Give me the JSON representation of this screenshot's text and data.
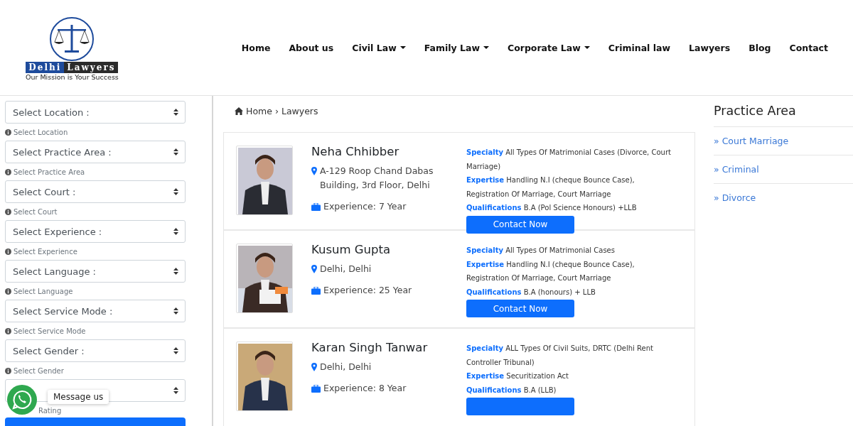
{
  "logo": {
    "name_part_1": "Delhi",
    "name_part_2": "Lawyers",
    "tagline": "Our Mission is Your Success"
  },
  "nav": [
    {
      "label": "Home",
      "dropdown": false
    },
    {
      "label": "About us",
      "dropdown": false
    },
    {
      "label": "Civil Law",
      "dropdown": true
    },
    {
      "label": "Family Law",
      "dropdown": true
    },
    {
      "label": "Corporate Law",
      "dropdown": true
    },
    {
      "label": "Criminal law",
      "dropdown": false
    },
    {
      "label": "Lawyers",
      "dropdown": false
    },
    {
      "label": "Blog",
      "dropdown": false
    },
    {
      "label": "Contact",
      "dropdown": false
    }
  ],
  "filters": [
    {
      "value": "Select Location :",
      "hint": "Select Location"
    },
    {
      "value": "Select Practice Area :",
      "hint": "Select Practice Area"
    },
    {
      "value": "Select Court :",
      "hint": "Select Court"
    },
    {
      "value": "Select Experience :",
      "hint": "Select Experience"
    },
    {
      "value": "Select Language :",
      "hint": "Select Language"
    },
    {
      "value": "Select Service Mode :",
      "hint": "Select Service Mode"
    },
    {
      "value": "Select Gender :",
      "hint": "Select Gender"
    },
    {
      "kind": "covered",
      "hint": "Rating"
    }
  ],
  "chat_widget": {
    "label": "Message us"
  },
  "breadcrumb": {
    "home": "Home",
    "separator": "›",
    "current": "Lawyers"
  },
  "lawyers": [
    {
      "name": "Neha Chhibber",
      "address": "A-129 Roop Chand Dabas Building, 3rd Floor, Delhi",
      "experience": "Experience: 7 Year",
      "details": [
        {
          "label": "Specialty",
          "text": "All Types Of Matrimonial Cases (Divorce, Court Marriage)"
        },
        {
          "label": "Expertise",
          "text": "Handling N.I (cheque Bounce Case), Registration Of Marriage, Court Marriage"
        },
        {
          "label": "Qualifications",
          "text": "B.A (Pol Science Honours) +LLB"
        }
      ],
      "button": "Contact Now"
    },
    {
      "name": "Kusum Gupta",
      "address": "Delhi, Delhi",
      "experience": "Experience: 25 Year",
      "details": [
        {
          "label": "Specialty",
          "text": "All Types Of Matrimonial Cases"
        },
        {
          "label": "Expertise",
          "text": "Handling N.I (cheque Bounce Case), Registration Of Marriage, Court Marriage"
        },
        {
          "label": "Qualifications",
          "text": "B.A (honours) + LLB"
        }
      ],
      "button": "Contact Now"
    },
    {
      "name": "Karan Singh Tanwar",
      "address": "Delhi, Delhi",
      "experience": "Experience: 8 Year",
      "details": [
        {
          "label": "Specialty",
          "text": "ALL Types Of Civil Suits, DRTC (Delhi Rent Controller Tribunal)"
        },
        {
          "label": "Expertise",
          "text": "Securitization Act"
        },
        {
          "label": "Qualifications",
          "text": "B.A (LLB)"
        }
      ]
    }
  ],
  "practice_area": {
    "title": "Practice Area",
    "marker": "»",
    "items": [
      "Court Marriage",
      "Criminal",
      "Divorce"
    ]
  }
}
